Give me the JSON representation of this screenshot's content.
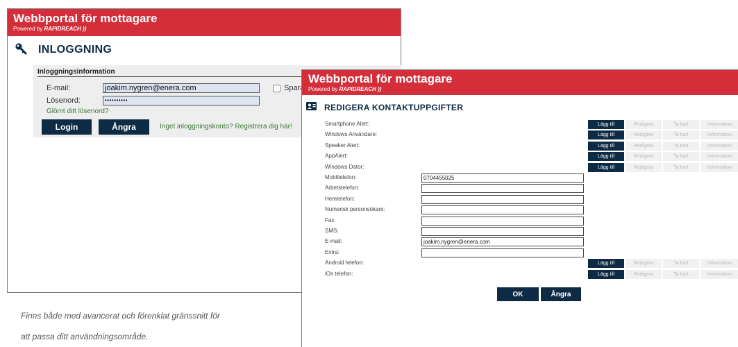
{
  "login_window": {
    "banner_title": "Webbportal för mottagare",
    "powered_by": "Powered by",
    "brand": "RAPIDREACH ))",
    "heading": "INLOGGNING",
    "panel_title": "Inloggningsinformation",
    "email_label": "E-mail:",
    "email_value": "joakim.nygren@enera.com",
    "password_label": "Lösenord:",
    "password_value": "••••••••••",
    "save_label": "Spara E-",
    "forgot_link": "Glömt ditt lösenord?",
    "login_button": "Login",
    "cancel_button": "Ångra",
    "register_link": "Inget inloggningskonto? Registrera dig här!"
  },
  "caption": {
    "line1": "Finns både med avancerat och förenklat gränssnitt för",
    "line2": "att passa ditt användningsområde."
  },
  "contact_window": {
    "banner_title": "Webbportal för mottagare",
    "powered_by": "Powered by",
    "brand": "RAPIDREACH ))",
    "heading": "REDIGERA KONTAKTUPPGIFTER",
    "service_buttons": [
      "Lägg till",
      "Redigera",
      "Ta bort",
      "Information"
    ],
    "rows": [
      {
        "label": "Smartphone Alert:",
        "type": "buttons",
        "value": ""
      },
      {
        "label": "Windows Användare:",
        "type": "buttons",
        "value": ""
      },
      {
        "label": "Speaker Alert:",
        "type": "buttons",
        "value": ""
      },
      {
        "label": "AppAlert:",
        "type": "buttons",
        "value": ""
      },
      {
        "label": "Windows Dator:",
        "type": "buttons",
        "value": ""
      },
      {
        "label": "Mobiltelefon:",
        "type": "input",
        "value": "0704455025"
      },
      {
        "label": "Arbetstelefon:",
        "type": "input",
        "value": ""
      },
      {
        "label": "Hemtelefon:",
        "type": "input",
        "value": ""
      },
      {
        "label": "Numerisk personsökare:",
        "type": "input",
        "value": ""
      },
      {
        "label": "Fax:",
        "type": "input",
        "value": ""
      },
      {
        "label": "SMS:",
        "type": "input",
        "value": ""
      },
      {
        "label": "E-mail:",
        "type": "input",
        "value": "joakim.nygren@enera.com"
      },
      {
        "label": "Extra:",
        "type": "input",
        "value": ""
      },
      {
        "label": "Android telefon:",
        "type": "buttons",
        "value": ""
      },
      {
        "label": "iOs telefon:",
        "type": "buttons",
        "value": ""
      }
    ],
    "ok_button": "OK",
    "cancel_button": "Ångra"
  },
  "colors": {
    "banner_red": "#d42e3a",
    "navy": "#0d2b45",
    "link_green": "#3a7a32",
    "input_blue": "#dde4f2"
  }
}
